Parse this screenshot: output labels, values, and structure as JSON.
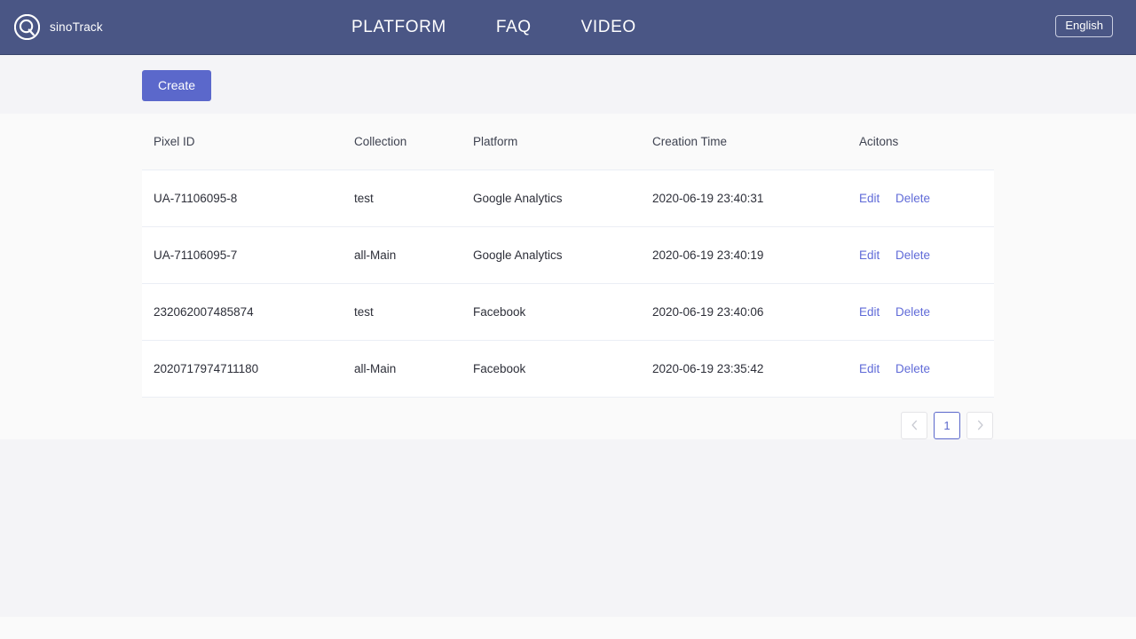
{
  "header": {
    "brand_name": "sinoTrack",
    "logo_icon": "circle-q-logo-icon",
    "nav": [
      {
        "label": "PLATFORM",
        "name": "nav-link-platform"
      },
      {
        "label": "FAQ",
        "name": "nav-link-faq"
      },
      {
        "label": "VIDEO",
        "name": "nav-link-video"
      }
    ],
    "language": "English",
    "bg_color": "#4a5685"
  },
  "toolbar": {
    "create_label": "Create",
    "create_color": "#5b68cb"
  },
  "table": {
    "columns": [
      {
        "key": "pixel_id",
        "label": "Pixel ID"
      },
      {
        "key": "collection",
        "label": "Collection"
      },
      {
        "key": "platform",
        "label": "Platform"
      },
      {
        "key": "creation_time",
        "label": "Creation Time"
      },
      {
        "key": "actions",
        "label": "Acitons"
      }
    ],
    "rows": [
      {
        "pixel_id": "UA-71106095-8",
        "collection": "test",
        "platform": "Google Analytics",
        "creation_time": "2020-06-19 23:40:31",
        "edit_label": "Edit",
        "delete_label": "Delete"
      },
      {
        "pixel_id": "UA-71106095-7",
        "collection": "all-Main",
        "platform": "Google Analytics",
        "creation_time": "2020-06-19 23:40:19",
        "edit_label": "Edit",
        "delete_label": "Delete"
      },
      {
        "pixel_id": "232062007485874",
        "collection": "test",
        "platform": "Facebook",
        "creation_time": "2020-06-19 23:40:06",
        "edit_label": "Edit",
        "delete_label": "Delete"
      },
      {
        "pixel_id": "2020717974711180",
        "collection": "all-Main",
        "platform": "Facebook",
        "creation_time": "2020-06-19 23:35:42",
        "edit_label": "Edit",
        "delete_label": "Delete"
      }
    ],
    "link_color": "#606bd8"
  },
  "pagination": {
    "prev_icon": "chevron-left-icon",
    "next_icon": "chevron-right-icon",
    "pages": [
      {
        "label": "1",
        "active": true
      }
    ],
    "active_color": "#5b68cb"
  }
}
